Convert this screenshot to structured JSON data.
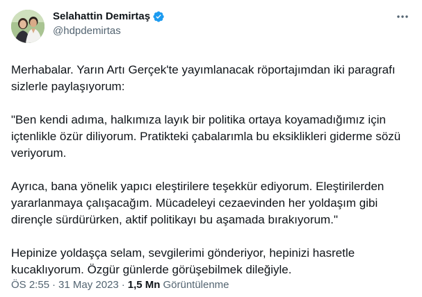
{
  "author": {
    "display_name": "Selahattin Demirtaş",
    "handle": "@hdpdemirtas",
    "verified": true,
    "verified_color": "#1d9bf0"
  },
  "icons": {
    "verified": "verified-badge-icon",
    "more": "more-options-icon"
  },
  "tweet": {
    "paragraphs": [
      "Merhabalar. Yarın Artı Gerçek'te yayımlanacak röportajımdan iki paragrafı sizlerle paylaşıyorum:",
      "\"Ben kendi adıma, halkımıza layık bir politika ortaya koyamadığımız için içtenlikle özür diliyorum. Pratikteki çabalarımla bu eksiklikleri giderme sözü veriyorum.",
      "Ayrıca, bana yönelik yapıcı eleştirilere teşekkür ediyorum. Eleştirilerden yararlanmaya çalışacağım. Mücadeleyi cezaevinden her yoldaşım gibi dirençle sürdürürken, aktif politikayı bu aşamada bırakıyorum.\"",
      "Hepinize yoldaşça selam, sevgilerimi gönderiyor, hepinizi hasretle kucaklıyorum. Özgür günlerde görüşebilmek dileğiyle."
    ]
  },
  "meta": {
    "time": "ÖS 2:55",
    "separator": "·",
    "date": "31 May 2023",
    "views_count": "1,5 Mn",
    "views_label": "Görüntülenme"
  },
  "colors": {
    "text_primary": "#0f1419",
    "text_secondary": "#536471",
    "background": "#ffffff"
  }
}
